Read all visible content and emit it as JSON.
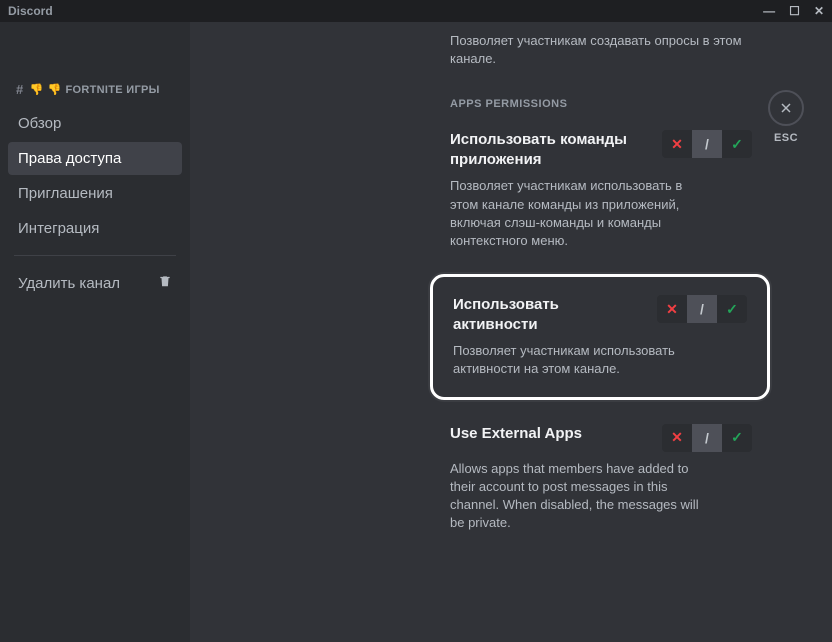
{
  "titlebar": {
    "title": "Discord"
  },
  "channel": {
    "prefix": "#",
    "emojiA": "👎",
    "emojiB": "👎",
    "name": "FORTNITE ИГРЫ"
  },
  "sidebar": {
    "items": [
      {
        "label": "Обзор",
        "active": false
      },
      {
        "label": "Права доступа",
        "active": true
      },
      {
        "label": "Приглашения",
        "active": false
      },
      {
        "label": "Интеграция",
        "active": false
      }
    ],
    "delete": "Удалить канал"
  },
  "esc": {
    "label": "ESC"
  },
  "top_desc": "Позволяет участникам создавать опросы в этом канале.",
  "section_header": "APPS PERMISSIONS",
  "perms": [
    {
      "title": "Использовать команды приложения",
      "desc": "Позволяет участникам использовать в этом канале команды из приложений, включая слэш-команды и команды контекстного меню."
    },
    {
      "title": "Использовать активности",
      "desc": "Позволяет участникам использовать активности на этом канале."
    },
    {
      "title": "Use External Apps",
      "desc": "Allows apps that members have added to their account to post messages in this channel. When disabled, the messages will be private."
    }
  ],
  "toggle": {
    "deny": "✕",
    "neutral": "/",
    "allow": "✓"
  }
}
